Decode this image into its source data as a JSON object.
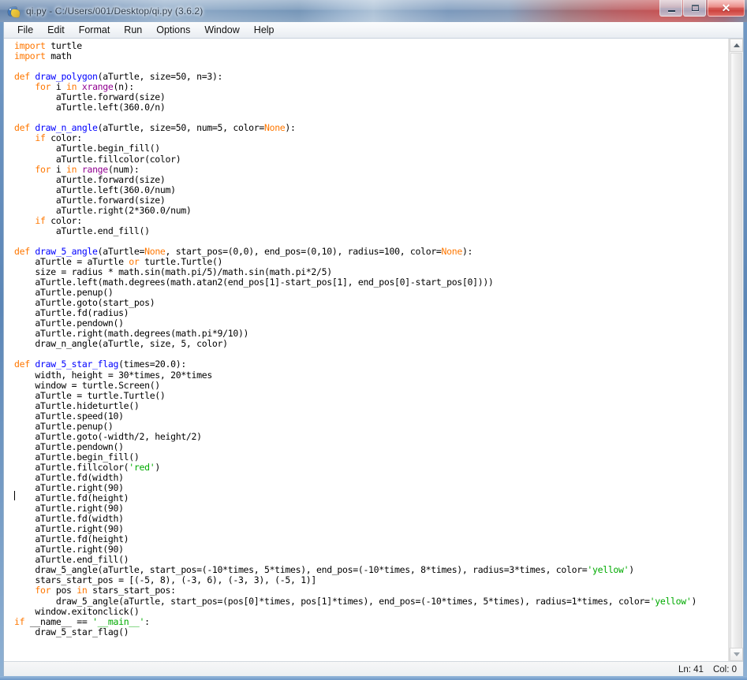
{
  "window": {
    "title": "qi.py - C:/Users/001/Desktop/qi.py (3.6.2)",
    "icon": "python-idle-icon",
    "minimize_label": "–",
    "maximize_label": "□",
    "close_label": "✕"
  },
  "menubar": {
    "items": [
      {
        "label": "File"
      },
      {
        "label": "Edit"
      },
      {
        "label": "Format"
      },
      {
        "label": "Run"
      },
      {
        "label": "Options"
      },
      {
        "label": "Window"
      },
      {
        "label": "Help"
      }
    ]
  },
  "statusbar": {
    "line_label": "Ln: 41",
    "col_label": "Col: 0"
  },
  "scrollbar": {
    "up_arrow": "scroll-up-icon",
    "down_arrow": "scroll-down-icon"
  },
  "colors": {
    "keyword": "#ff7700",
    "definition": "#0000ff",
    "builtin": "#900090",
    "string": "#00aa00",
    "text": "#000000",
    "editor_background": "#ffffff",
    "close_button": "#c62b26"
  },
  "editor": {
    "filename": "qi.py",
    "language": "python",
    "cursor_line": 41,
    "cursor_col": 0,
    "lines": [
      "import turtle",
      "import math",
      "",
      "def draw_polygon(aTurtle, size=50, n=3):",
      "    for i in xrange(n):",
      "        aTurtle.forward(size)",
      "        aTurtle.left(360.0/n)",
      "",
      "def draw_n_angle(aTurtle, size=50, num=5, color=None):",
      "    if color:",
      "        aTurtle.begin_fill()",
      "        aTurtle.fillcolor(color)",
      "    for i in range(num):",
      "        aTurtle.forward(size)",
      "        aTurtle.left(360.0/num)",
      "        aTurtle.forward(size)",
      "        aTurtle.right(2*360.0/num)",
      "    if color:",
      "        aTurtle.end_fill()",
      "",
      "def draw_5_angle(aTurtle=None, start_pos=(0,0), end_pos=(0,10), radius=100, color=None):",
      "    aTurtle = aTurtle or turtle.Turtle()",
      "    size = radius * math.sin(math.pi/5)/math.sin(math.pi*2/5)",
      "    aTurtle.left(math.degrees(math.atan2(end_pos[1]-start_pos[1], end_pos[0]-start_pos[0])))",
      "    aTurtle.penup()",
      "    aTurtle.goto(start_pos)",
      "    aTurtle.fd(radius)",
      "    aTurtle.pendown()",
      "    aTurtle.right(math.degrees(math.pi*9/10))",
      "    draw_n_angle(aTurtle, size, 5, color)",
      "",
      "def draw_5_star_flag(times=20.0):",
      "    width, height = 30*times, 20*times",
      "    window = turtle.Screen()",
      "    aTurtle = turtle.Turtle()",
      "    aTurtle.hideturtle()",
      "    aTurtle.speed(10)",
      "    aTurtle.penup()",
      "    aTurtle.goto(-width/2, height/2)",
      "    aTurtle.pendown()",
      "    aTurtle.begin_fill()",
      "    aTurtle.fillcolor('red')",
      "    aTurtle.fd(width)",
      "    aTurtle.right(90)",
      "    aTurtle.fd(height)",
      "    aTurtle.right(90)",
      "    aTurtle.fd(width)",
      "    aTurtle.right(90)",
      "    aTurtle.fd(height)",
      "    aTurtle.right(90)",
      "    aTurtle.end_fill()",
      "    draw_5_angle(aTurtle, start_pos=(-10*times, 5*times), end_pos=(-10*times, 8*times), radius=3*times, color='yellow')",
      "    stars_start_pos = [(-5, 8), (-3, 6), (-3, 3), (-5, 1)]",
      "    for pos in stars_start_pos:",
      "        draw_5_angle(aTurtle, start_pos=(pos[0]*times, pos[1]*times), end_pos=(-10*times, 5*times), radius=1*times, color='yellow')",
      "    window.exitonclick()",
      "if __name__ == '__main__':",
      "    draw_5_star_flag()"
    ],
    "highlight_tokens": {
      "keywords": [
        "import",
        "def",
        "for",
        "in",
        "if",
        "or",
        "None"
      ],
      "builtins": [
        "xrange",
        "range"
      ],
      "definitions": [
        "draw_polygon",
        "draw_n_angle",
        "draw_5_angle",
        "draw_5_star_flag"
      ],
      "strings": [
        "'red'",
        "'yellow'",
        "'__main__'"
      ]
    }
  }
}
